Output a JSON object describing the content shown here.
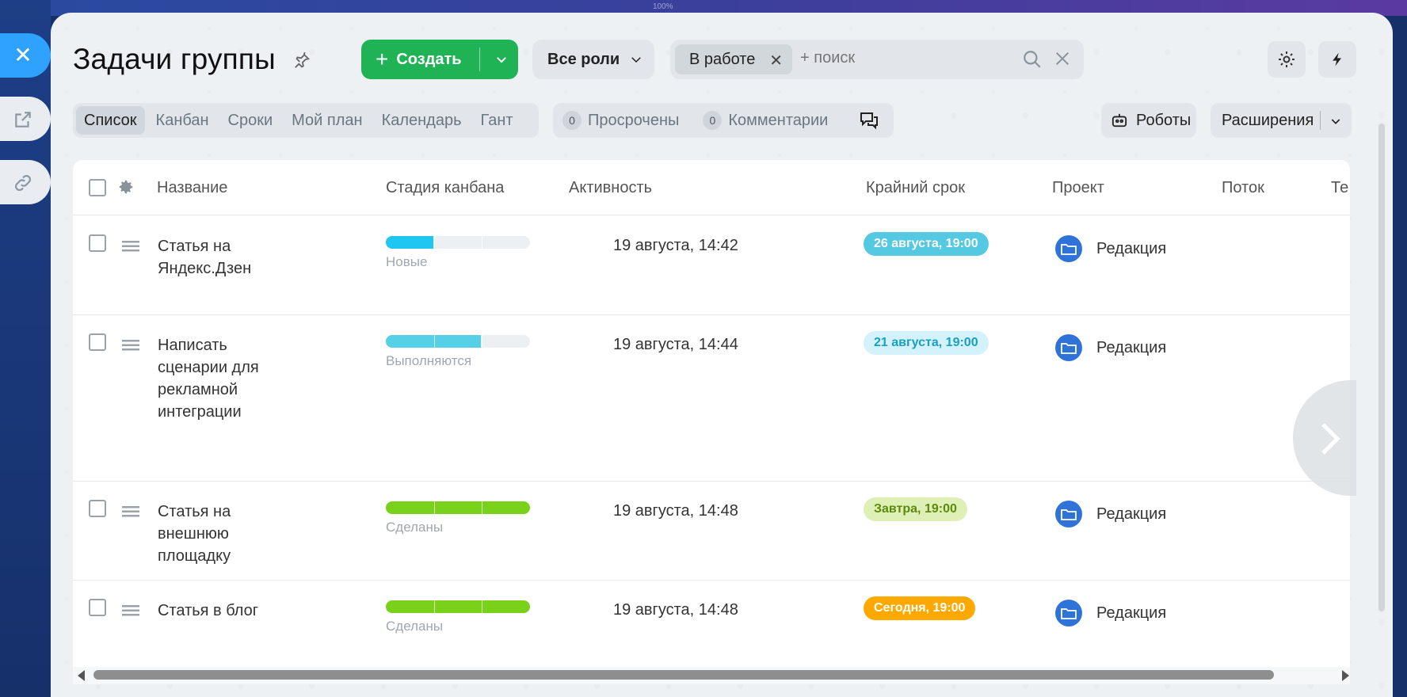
{
  "background": {
    "zoom_label": "100%"
  },
  "header": {
    "title": "Задачи группы",
    "create_label": "Создать",
    "roles_label": "Все роли",
    "filter_chip": "В работе",
    "search_placeholder": "+ поиск"
  },
  "views": [
    "Список",
    "Канбан",
    "Сроки",
    "Мой план",
    "Календарь",
    "Гант"
  ],
  "counters": [
    {
      "count": "0",
      "label": "Просрочены"
    },
    {
      "count": "0",
      "label": "Комментарии"
    }
  ],
  "toolbar": {
    "robots_label": "Роботы",
    "extensions_label": "Расширения"
  },
  "columns": {
    "name": "Название",
    "stage": "Стадия канбана",
    "activity": "Активность",
    "deadline": "Крайний срок",
    "project": "Проект",
    "flow": "Поток",
    "tags": "Те"
  },
  "rows": [
    {
      "name": "Статья на Яндекс.Дзен",
      "stage": "Новые",
      "stage_progress": 0.33,
      "stage_color": "#1ec6f0",
      "activity": "19 августа, 14:42",
      "deadline": "26 августа, 19:00",
      "deadline_bg": "#55c8e2",
      "deadline_fg": "#ffffff",
      "project": "Редакция"
    },
    {
      "name": "Написать сценарии для рекламной интеграции",
      "stage": "Выполняются",
      "stage_progress": 0.66,
      "stage_color": "#55d0e6",
      "activity": "19 августа, 14:44",
      "deadline": "21 августа, 19:00",
      "deadline_bg": "#d3f2fb",
      "deadline_fg": "#1a9fc4",
      "project": "Редакция"
    },
    {
      "name": "Статья на внешнюю площадку",
      "stage": "Сделаны",
      "stage_progress": 1.0,
      "stage_color": "#7ad11a",
      "activity": "19 августа, 14:48",
      "deadline": "Завтра, 19:00",
      "deadline_bg": "#dff0b6",
      "deadline_fg": "#5c8a0b",
      "project": "Редакция"
    },
    {
      "name": "Статья в блог",
      "stage": "Сделаны",
      "stage_progress": 1.0,
      "stage_color": "#7ad11a",
      "activity": "19 августа, 14:48",
      "deadline": "Сегодня, 19:00",
      "deadline_bg": "#ffa800",
      "deadline_fg": "#ffffff",
      "project": "Редакция"
    }
  ]
}
